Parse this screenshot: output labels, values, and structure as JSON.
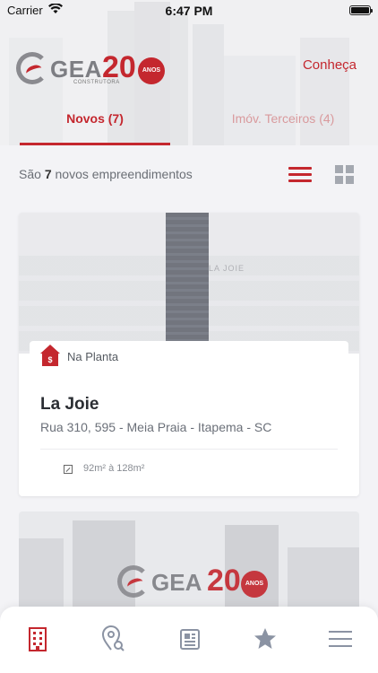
{
  "status_bar": {
    "carrier": "Carrier",
    "time": "6:47 PM"
  },
  "header": {
    "logo": {
      "word": "GEA",
      "sub": "CONSTRUTORA",
      "number": "20",
      "badge": "ANOS"
    },
    "link_label": "Conheça"
  },
  "tabs": [
    {
      "label": "Novos (7)",
      "active": true
    },
    {
      "label": "Imóv. Terceiros (4)",
      "active": false
    }
  ],
  "summary": {
    "prefix": "São",
    "count": "7",
    "suffix": "novos empreendimentos"
  },
  "view_toggle": {
    "active": "list"
  },
  "listings": [
    {
      "badge_symbol": "$",
      "status": "Na Planta",
      "name": "La Joie",
      "address": "Rua 310, 595 - Meia Praia - Itapema - SC",
      "area": "92m² à 128m²",
      "photo_text": "LA JOIE"
    }
  ],
  "bottom_nav": [
    {
      "icon": "building-icon",
      "active": true
    },
    {
      "icon": "map-search-icon",
      "active": false
    },
    {
      "icon": "news-icon",
      "active": false
    },
    {
      "icon": "star-icon",
      "active": false
    },
    {
      "icon": "menu-icon",
      "active": false
    }
  ],
  "colors": {
    "brand_red": "#c4272e",
    "inactive_icon": "#8b93a3",
    "grid_icon": "#a4a8b0"
  }
}
